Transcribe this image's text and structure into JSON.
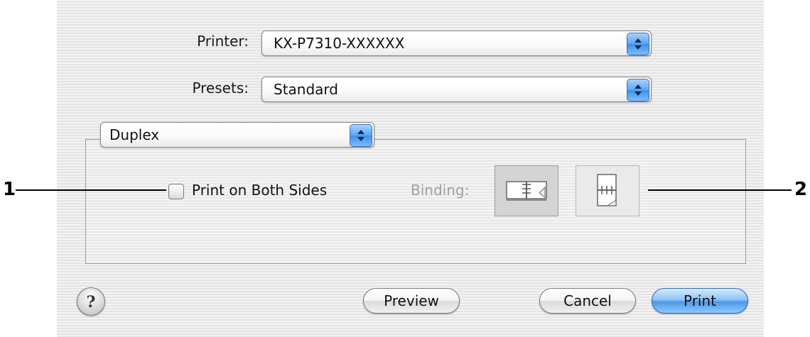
{
  "dialog": {
    "printer": {
      "label": "Printer:",
      "value": "KX-P7310-XXXXXX"
    },
    "presets": {
      "label": "Presets:",
      "value": "Standard"
    },
    "panel": {
      "value": "Duplex"
    },
    "duplex": {
      "checkbox_label": "Print on Both Sides",
      "checked": false,
      "binding_label": "Binding:",
      "binding_options": [
        "long-edge-binding-icon",
        "short-edge-binding-icon"
      ]
    },
    "help_symbol": "?",
    "buttons": {
      "preview": "Preview",
      "cancel": "Cancel",
      "print": "Print"
    }
  },
  "callouts": [
    "1",
    "2"
  ],
  "colors": {
    "accent_blue": "#4f98e8",
    "disabled_text": "#a0a0a0"
  }
}
